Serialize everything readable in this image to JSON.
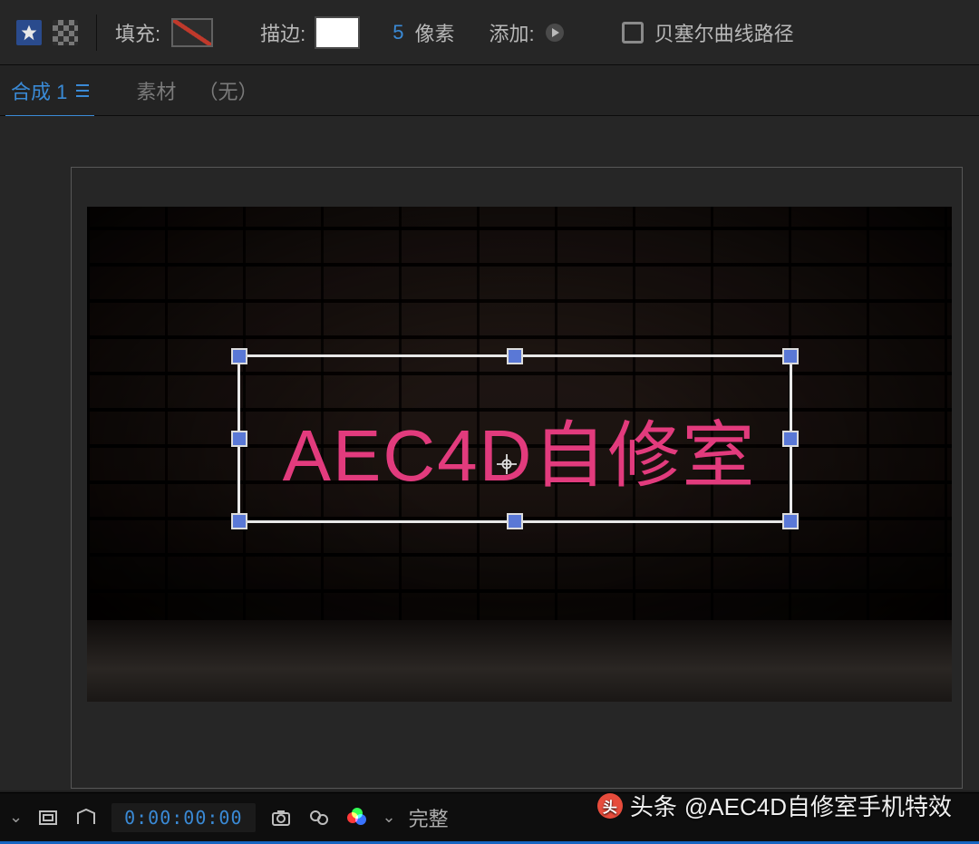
{
  "toolbar": {
    "fill_label": "填充:",
    "stroke_label": "描边:",
    "stroke_width": "5",
    "stroke_unit": "像素",
    "add_label": "添加:",
    "bezier_label": "贝塞尔曲线路径"
  },
  "tabs": {
    "active": "合成 1",
    "footage_label": "素材",
    "none_label": "（无）"
  },
  "canvas": {
    "text_content": "AEC4D自修室",
    "text_color": "#e23b7d"
  },
  "bottombar": {
    "timecode": "0:00:00:00",
    "resolution": "完整"
  },
  "watermark": {
    "prefix": "头条",
    "handle": "@AEC4D自修室手机特效"
  }
}
